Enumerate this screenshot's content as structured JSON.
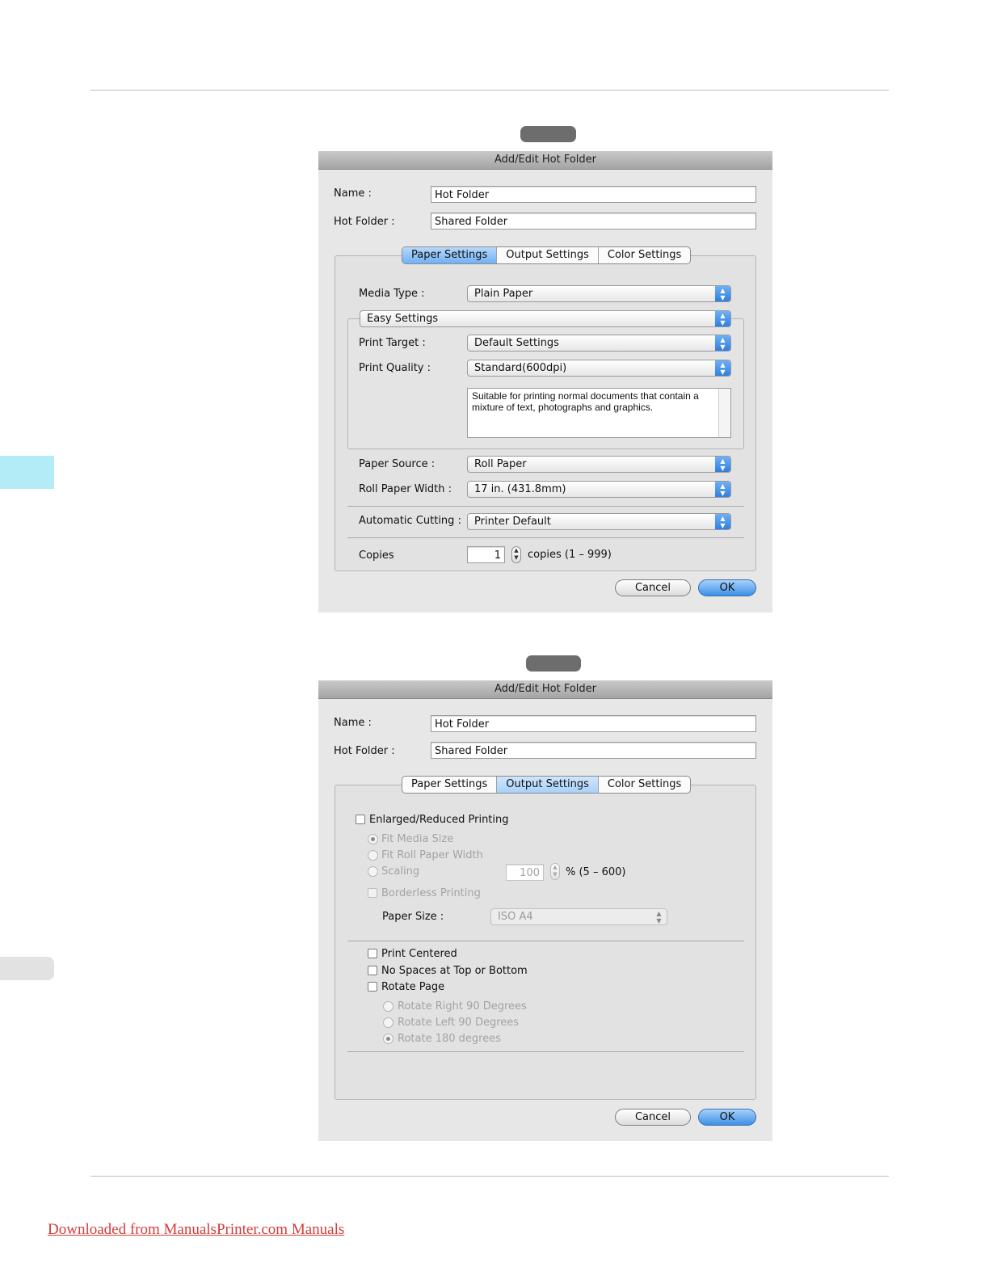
{
  "colors": {
    "accent": "#b3ecf7",
    "side_tab_gray": "#e2e2e2",
    "footer_link": "#d43b3b"
  },
  "dialog1": {
    "title": "Add/Edit Hot Folder",
    "name_label": "Name :",
    "name_value": "Hot Folder",
    "hotfolder_label": "Hot Folder :",
    "hotfolder_value": "Shared Folder",
    "tabs": [
      "Paper Settings",
      "Output Settings",
      "Color Settings"
    ],
    "active_tab": "Paper Settings",
    "media_type_label": "Media Type :",
    "media_type_value": "Plain Paper",
    "mode_value": "Easy Settings",
    "print_target_label": "Print Target :",
    "print_target_value": "Default Settings",
    "print_quality_label": "Print Quality :",
    "print_quality_value": "Standard(600dpi)",
    "description": "Suitable for printing normal documents that contain a mixture of text, photographs and graphics.",
    "paper_source_label": "Paper Source :",
    "paper_source_value": "Roll Paper",
    "roll_width_label": "Roll Paper Width :",
    "roll_width_value": "17 in. (431.8mm)",
    "auto_cut_label": "Automatic Cutting :",
    "auto_cut_value": "Printer Default",
    "copies_label": "Copies",
    "copies_value": "1",
    "copies_range": "copies (1 – 999)",
    "cancel": "Cancel",
    "ok": "OK"
  },
  "dialog2": {
    "title": "Add/Edit Hot Folder",
    "name_label": "Name :",
    "name_value": "Hot Folder",
    "hotfolder_label": "Hot Folder :",
    "hotfolder_value": "Shared Folder",
    "tabs": [
      "Paper Settings",
      "Output Settings",
      "Color Settings"
    ],
    "active_tab": "Output Settings",
    "enlarged": "Enlarged/Reduced Printing",
    "fit_media": "Fit Media Size",
    "fit_roll": "Fit Roll Paper Width",
    "scaling": "Scaling",
    "scaling_value": "100",
    "scaling_range": "% (5 – 600)",
    "borderless": "Borderless Printing",
    "paper_size_label": "Paper Size :",
    "paper_size_value": "ISO A4",
    "print_centered": "Print Centered",
    "no_spaces": "No Spaces at Top or Bottom",
    "rotate_page": "Rotate Page",
    "rotate_right": "Rotate Right 90 Degrees",
    "rotate_left": "Rotate Left 90 Degrees",
    "rotate_180": "Rotate 180 degrees",
    "cancel": "Cancel",
    "ok": "OK"
  },
  "footer": {
    "link_text": "Downloaded from ManualsPrinter.com Manuals"
  }
}
